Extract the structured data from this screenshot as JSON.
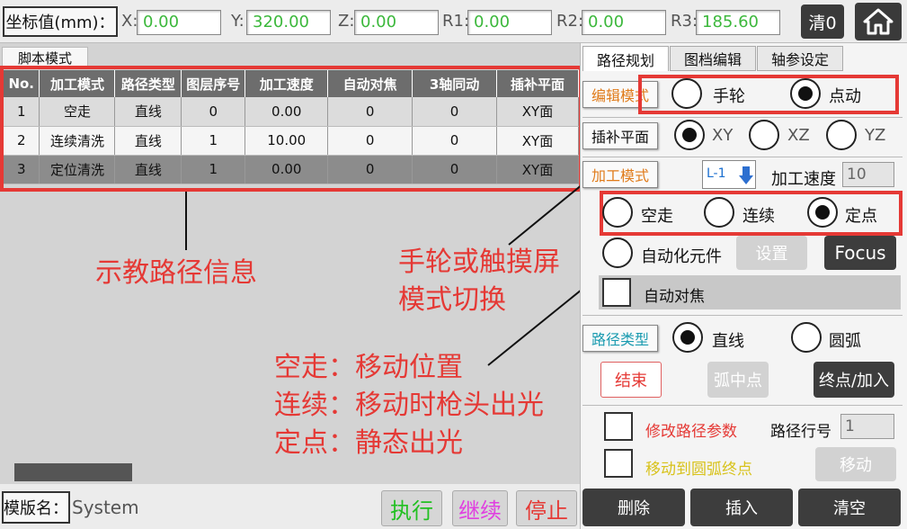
{
  "top": {
    "coord_label": "坐标值(mm)：",
    "fields": [
      {
        "label": "X:",
        "value": "0.00"
      },
      {
        "label": "Y:",
        "value": "320.00"
      },
      {
        "label": "Z:",
        "value": "0.00"
      },
      {
        "label": "R1:",
        "value": "0.00"
      },
      {
        "label": "R2:",
        "value": "0.00"
      },
      {
        "label": "R3:",
        "value": "185.60"
      }
    ],
    "clear_label": "清0"
  },
  "left": {
    "tab": "脚本模式",
    "headers": [
      "No.",
      "加工模式",
      "路径类型",
      "图层序号",
      "加工速度",
      "自动对焦",
      "3轴同动",
      "插补平面"
    ],
    "rows": [
      [
        "1",
        "空走",
        "直线",
        "0",
        "0.00",
        "0",
        "0",
        "XY面"
      ],
      [
        "2",
        "连续清洗",
        "直线",
        "1",
        "10.00",
        "0",
        "0",
        "XY面"
      ],
      [
        "3",
        "定位清洗",
        "直线",
        "1",
        "0.00",
        "0",
        "0",
        "XY面"
      ]
    ],
    "note1": "示教路径信息",
    "note2_l1": "手轮或触摸屏",
    "note2_l2": "模式切换",
    "note3_l1": "空走：移动位置",
    "note3_l2": "连续：移动时枪头出光",
    "note3_l3": "定点：静态出光"
  },
  "bottom": {
    "template_label": "模版名：",
    "template_value": "System",
    "run": "执行",
    "continue": "继续",
    "stop": "停止"
  },
  "right": {
    "tabs": [
      "路径规划",
      "图档编辑",
      "轴参设定"
    ],
    "edit_mode": "编辑模式",
    "handwheel": "手轮",
    "jog": "点动",
    "interp_plane": "插补平面",
    "xy": "XY",
    "xz": "XZ",
    "yz": "YZ",
    "proc_mode": "加工模式",
    "layer": "L-1",
    "proc_speed_label": "加工速度",
    "proc_speed_value": "10",
    "idle": "空走",
    "continuous": "连续",
    "fixed": "定点",
    "auto_elem": "自动化元件",
    "setup": "设置",
    "focus": "Focus",
    "auto_focus": "自动对焦",
    "path_type": "路径类型",
    "line": "直线",
    "arc": "圆弧",
    "end": "结束",
    "arc_mid": "弧中点",
    "end_add": "终点/加入",
    "modify_path": "修改路径参数",
    "path_row_label": "路径行号",
    "path_row_value": "1",
    "move_arc_end": "移动到圆弧终点",
    "move": "移动",
    "delete": "删除",
    "insert": "插入",
    "clear_all": "清空"
  },
  "colors": {
    "accent_red": "#e53935",
    "value_green": "#3cb83c",
    "section_orange": "#e07b1a",
    "section_teal": "#1a9bb0"
  }
}
